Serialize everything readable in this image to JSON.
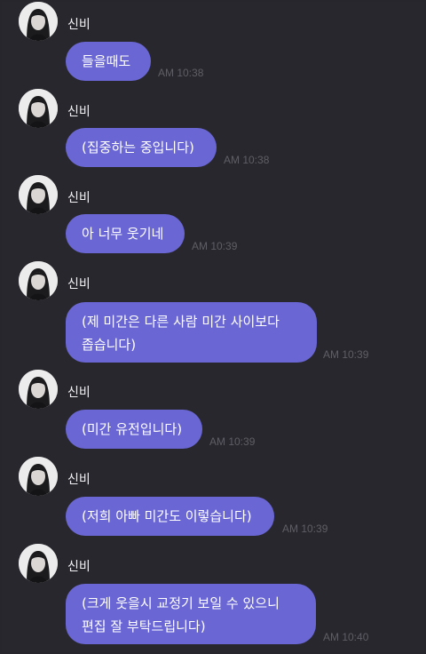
{
  "chat": {
    "messages": [
      {
        "sender": "신비",
        "lines": [
          "들을때도"
        ],
        "time": "AM 10:38"
      },
      {
        "sender": "신비",
        "lines": [
          "(집중하는 중입니다)"
        ],
        "time": "AM 10:38"
      },
      {
        "sender": "신비",
        "lines": [
          "아 너무 웃기네"
        ],
        "time": "AM 10:39"
      },
      {
        "sender": "신비",
        "lines": [
          "(제 미간은 다른 사람 미간 사이보다",
          "좁습니다)"
        ],
        "time": "AM 10:39"
      },
      {
        "sender": "신비",
        "lines": [
          "(미간 유전입니다)"
        ],
        "time": "AM 10:39"
      },
      {
        "sender": "신비",
        "lines": [
          "(저희 아빠 미간도 이렇습니다)"
        ],
        "time": "AM 10:39"
      },
      {
        "sender": "신비",
        "lines": [
          "(크게 웃을시 교정기 보일 수 있으니",
          "편집 잘 부탁드립니다)"
        ],
        "time": "AM 10:40"
      }
    ]
  },
  "colors": {
    "background": "#28272d",
    "bubble": "#6a67d4",
    "timestamp": "#5f5e66"
  },
  "icons": {
    "avatar": "profile-photo-avatar-icon"
  }
}
